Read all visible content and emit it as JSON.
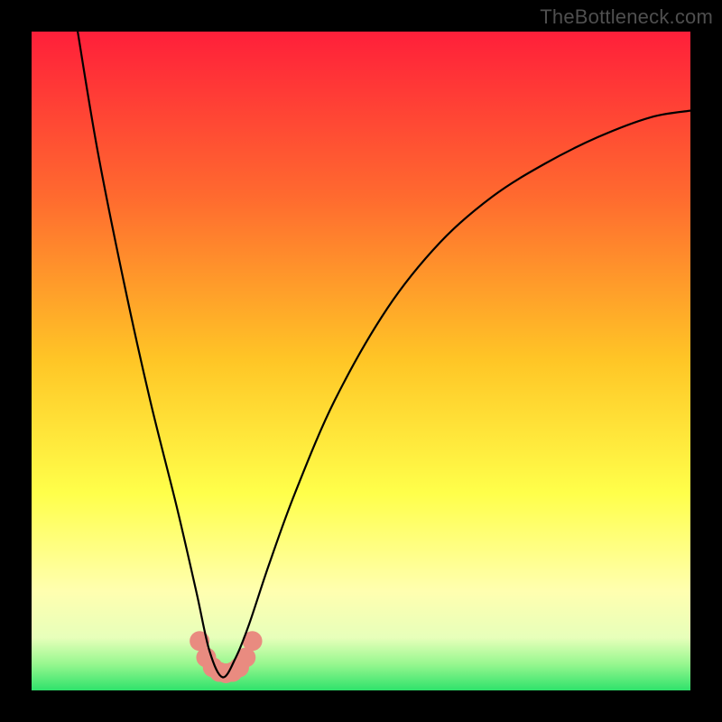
{
  "watermark": "TheBottleneck.com",
  "chart_data": {
    "type": "line",
    "title": "",
    "xlabel": "",
    "ylabel": "",
    "xlim": [
      0,
      100
    ],
    "ylim": [
      0,
      100
    ],
    "background_gradient": {
      "stops": [
        {
          "offset": 0,
          "color": "#ff1f3a"
        },
        {
          "offset": 25,
          "color": "#ff6a2f"
        },
        {
          "offset": 50,
          "color": "#ffc626"
        },
        {
          "offset": 70,
          "color": "#ffff4a"
        },
        {
          "offset": 85,
          "color": "#ffffb0"
        },
        {
          "offset": 92,
          "color": "#e7ffba"
        },
        {
          "offset": 96,
          "color": "#97f78f"
        },
        {
          "offset": 100,
          "color": "#2fe26b"
        }
      ]
    },
    "series": [
      {
        "name": "bottleneck-curve",
        "comment": "V-shaped dip, minimum near x≈29, y≈2; left arm rises to top-left, right arm rises to ~y=88 at x=100",
        "x": [
          7,
          10,
          14,
          18,
          22,
          25,
          27,
          29,
          31,
          33,
          36,
          40,
          46,
          54,
          62,
          70,
          78,
          86,
          94,
          100
        ],
        "y": [
          100,
          82,
          62,
          44,
          28,
          15,
          6,
          2,
          5,
          10,
          19,
          30,
          44,
          58,
          68,
          75,
          80,
          84,
          87,
          88
        ]
      },
      {
        "name": "marker-arc",
        "comment": "small U of salmon dots at the trough",
        "x": [
          25.5,
          26.5,
          27.5,
          28.5,
          29.5,
          30.5,
          31.5,
          32.5,
          33.5
        ],
        "y": [
          7.5,
          5.0,
          3.5,
          2.8,
          2.6,
          2.8,
          3.5,
          5.0,
          7.5
        ],
        "marker_color": "#e98b80",
        "marker_radius": 11
      }
    ]
  }
}
